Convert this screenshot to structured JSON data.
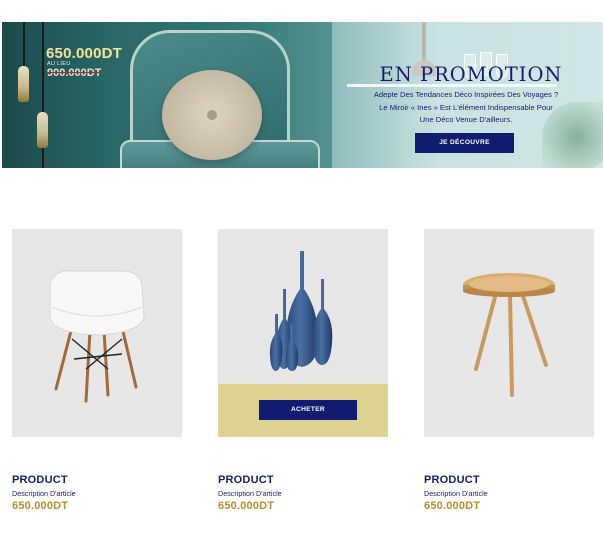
{
  "banner": {
    "price_new": "650.000DT",
    "price_label": "AU LIEU",
    "price_old": "900.000DT",
    "title": "EN PROMOTION",
    "description_lines": [
      "Adepte Des Tendances Déco Inspirées Des Voyages ?",
      "Le Miroir « Ines » Est L'élément Indispensable Pour",
      "Une Déco Venue D'ailleurs."
    ],
    "cta_label": "JE DÉCOUVRE"
  },
  "products": [
    {
      "image": "white-chair",
      "title": "PRODUCT",
      "description": "Description D'article",
      "price": "650.000DT"
    },
    {
      "image": "blue-vases",
      "title": "PRODUCT",
      "description": "Description D'article",
      "price": "650.000DT",
      "action_label": "ACHETER"
    },
    {
      "image": "wooden-stool",
      "title": "PRODUCT",
      "description": "Description D'article",
      "price": "650.000DT"
    }
  ],
  "colors": {
    "navy": "#151c6b",
    "button": "#0f1c6f",
    "gold_price": "#b58d2a",
    "hover_panel": "#ddd28f",
    "card_bg": "#e7e7e7",
    "banner_price": "#f3e39a"
  }
}
